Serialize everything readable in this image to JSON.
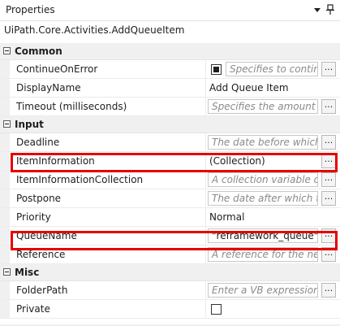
{
  "panel": {
    "title": "Properties",
    "dropdown_icon": "triangle-down",
    "pin_icon": "pin",
    "activity_type": "UiPath.Core.Activities.AddQueueItem"
  },
  "categories": {
    "common": {
      "label": "Common",
      "continue_on_error": {
        "name": "ContinueOnError",
        "checked": true,
        "placeholder": "Specifies to continue"
      },
      "display_name": {
        "name": "DisplayName",
        "value": "Add Queue Item"
      },
      "timeout": {
        "name": "Timeout (milliseconds)",
        "placeholder": "Specifies the amount of t"
      }
    },
    "input": {
      "label": "Input",
      "deadline": {
        "name": "Deadline",
        "placeholder": "The date before which th"
      },
      "item_information": {
        "name": "ItemInformation",
        "value": "(Collection)"
      },
      "item_information_collection": {
        "name": "ItemInformationCollection",
        "placeholder": "A collection variable of a"
      },
      "postpone": {
        "name": "Postpone",
        "placeholder": "The date after which the"
      },
      "priority": {
        "name": "Priority",
        "value": "Normal"
      },
      "queue_name": {
        "name": "QueueName",
        "value": "\"reframework_queue\""
      },
      "reference": {
        "name": "Reference",
        "placeholder": "A reference for the new Q"
      }
    },
    "misc": {
      "label": "Misc",
      "folder_path": {
        "name": "FolderPath",
        "placeholder": "Enter a VB expression"
      },
      "private": {
        "name": "Private",
        "checked": false
      }
    }
  },
  "ellipsis_label": "...",
  "colors": {
    "highlight": "#e60000",
    "category_bg": "#f0f0f0"
  }
}
